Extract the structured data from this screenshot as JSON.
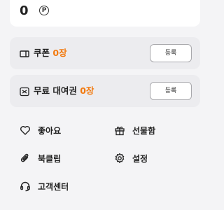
{
  "points": {
    "value": "0",
    "unit": "P"
  },
  "coupon": {
    "label": "쿠폰",
    "count": "0장",
    "button": "등록",
    "icon": "coupon-icon"
  },
  "free_rental": {
    "label": "무료 대여권",
    "count": "0장",
    "button": "등록",
    "icon": "ticket-icon"
  },
  "menu": {
    "likes": {
      "label": "좋아요",
      "icon": "heart-icon"
    },
    "gift_box": {
      "label": "선물함",
      "icon": "gift-icon"
    },
    "bookclip": {
      "label": "북클립",
      "icon": "paperclip-icon"
    },
    "settings": {
      "label": "설정",
      "icon": "gear-icon"
    },
    "support": {
      "label": "고객센터",
      "icon": "headset-icon"
    }
  },
  "colors": {
    "accent": "#f27a0f",
    "background": "#f4f4f6",
    "card": "#ececef"
  }
}
